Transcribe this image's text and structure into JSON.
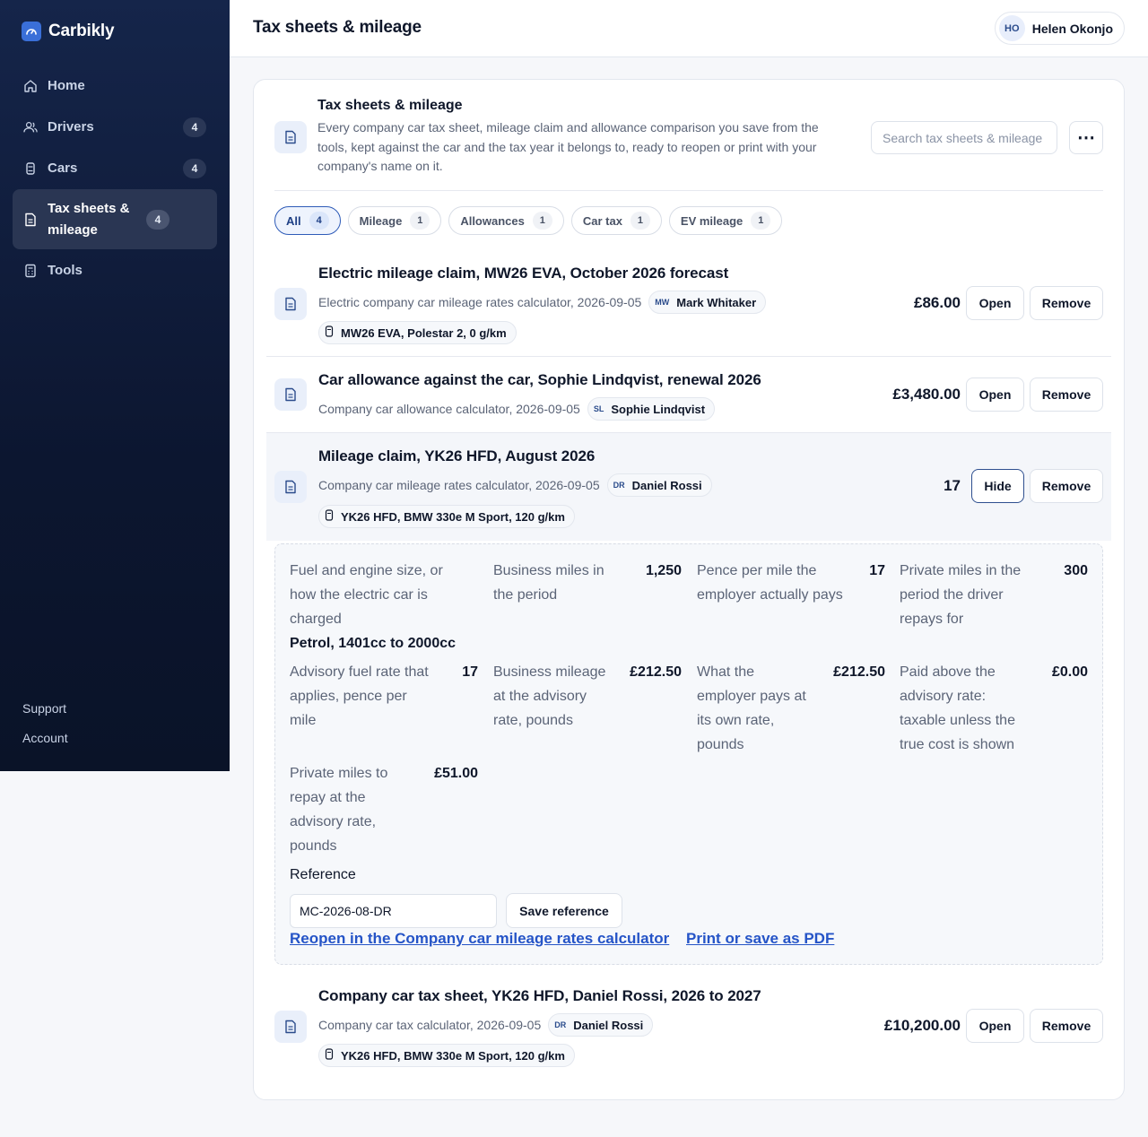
{
  "brand": {
    "name": "Carbikly"
  },
  "sidebar": {
    "items": [
      {
        "label": "Home",
        "icon": "home-icon",
        "count": ""
      },
      {
        "label": "Drivers",
        "icon": "users-icon",
        "count": "4"
      },
      {
        "label": "Cars",
        "icon": "car-icon",
        "count": "4"
      },
      {
        "label": "Tax sheets & mileage",
        "icon": "document-icon",
        "count": "4"
      },
      {
        "label": "Tools",
        "icon": "calculator-icon",
        "count": ""
      }
    ],
    "footer": {
      "support": "Support",
      "account": "Account"
    }
  },
  "header": {
    "title": "Tax sheets & mileage",
    "user": {
      "initials": "HO",
      "name": "Helen Okonjo"
    }
  },
  "panel": {
    "title": "Tax sheets & mileage",
    "description": "Every company car tax sheet, mileage claim and allowance comparison you save from the tools, kept against the car and the tax year it belongs to, ready to reopen or print with your company's name on it.",
    "search_placeholder": "Search tax sheets & mileage",
    "more_label": "⋯"
  },
  "filters": [
    {
      "label": "All",
      "count": "4"
    },
    {
      "label": "Mileage",
      "count": "1"
    },
    {
      "label": "Allowances",
      "count": "1"
    },
    {
      "label": "Car tax",
      "count": "1"
    },
    {
      "label": "EV mileage",
      "count": "1"
    }
  ],
  "rows": [
    {
      "title": "Electric mileage claim, MW26 EVA, October 2026 forecast",
      "source": "Electric company car mileage rates calculator, 2026-09-05",
      "person_initials": "MW",
      "person": "Mark Whitaker",
      "car": "MW26 EVA, Polestar 2, 0 g/km",
      "amount": "£86.00",
      "open": "Open",
      "remove": "Remove"
    },
    {
      "title": "Car allowance against the car, Sophie Lindqvist, renewal 2026",
      "source": "Company car allowance calculator, 2026-09-05",
      "person_initials": "SL",
      "person": "Sophie Lindqvist",
      "amount": "£3,480.00",
      "open": "Open",
      "remove": "Remove"
    },
    {
      "title": "Mileage claim, YK26 HFD, August 2026",
      "source": "Company car mileage rates calculator, 2026-09-05",
      "person_initials": "DR",
      "person": "Daniel Rossi",
      "car": "YK26 HFD, BMW 330e M Sport, 120 g/km",
      "amount": "17",
      "hide": "Hide",
      "remove": "Remove"
    },
    {
      "title": "Company car tax sheet, YK26 HFD, Daniel Rossi, 2026 to 2027",
      "source": "Company car tax calculator, 2026-09-05",
      "person_initials": "DR",
      "person": "Daniel Rossi",
      "car": "YK26 HFD, BMW 330e M Sport, 120 g/km",
      "amount": "£10,200.00",
      "open": "Open",
      "remove": "Remove"
    }
  ],
  "detail": {
    "fields": [
      {
        "label": "Fuel and engine size, or how the electric car is charged",
        "value": "Petrol, 1401cc to 2000cc"
      },
      {
        "label": "Business miles in the period",
        "value": "1,250"
      },
      {
        "label": "Pence per mile the employer actually pays",
        "value": "17"
      },
      {
        "label": "Private miles in the period the driver repays for",
        "value": "300"
      },
      {
        "label": "Advisory fuel rate that applies, pence per mile",
        "value": "17"
      },
      {
        "label": "Business mileage at the advisory rate, pounds",
        "value": "£212.50"
      },
      {
        "label": "What the employer pays at its own rate, pounds",
        "value": "£212.50"
      },
      {
        "label": "Paid above the advisory rate: taxable unless the true cost is shown",
        "value": "£0.00"
      },
      {
        "label": "Private miles to repay at the advisory rate, pounds",
        "value": "£51.00"
      }
    ],
    "reference_label": "Reference",
    "reference_value": "MC-2026-08-DR",
    "save_reference": "Save reference",
    "reopen_link": "Reopen in the Company car mileage rates calculator",
    "print_link": "Print or save as PDF"
  },
  "colors": {
    "accent": "#2554c7",
    "sidebar_bg": "#0c1630",
    "active_pill": "#2e5bb8"
  }
}
